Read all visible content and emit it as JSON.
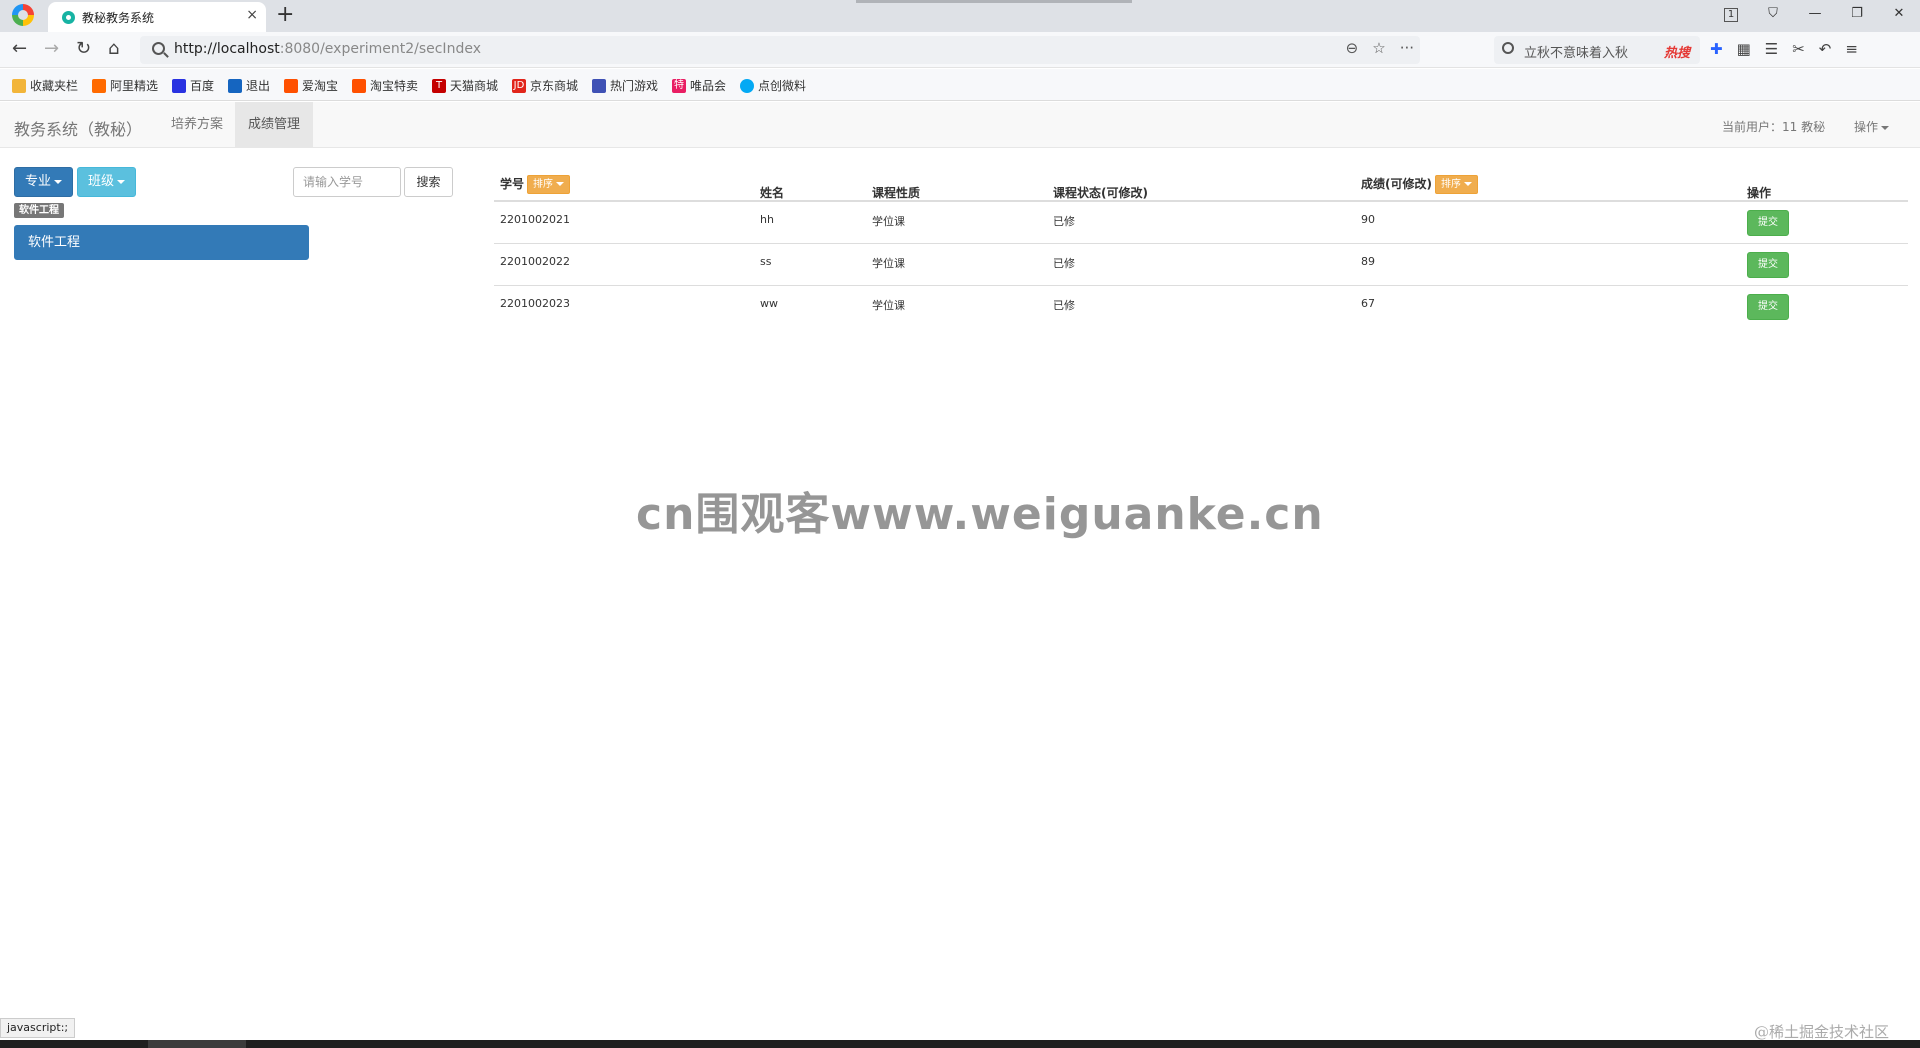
{
  "browser": {
    "tab_title": "教秘教务系统",
    "tab_close": "×",
    "new_tab": "+",
    "url_host": "http://localhost",
    "url_rest": ":8080/experiment2/secIndex",
    "hot_search_text": "立秋不意味着入秋",
    "hot_badge": "热搜",
    "tab_counter": "1",
    "bookmarks": [
      "收藏夹栏",
      "阿里精选",
      "百度",
      "退出",
      "爱淘宝",
      "淘宝特卖",
      "天猫商城",
      "京东商城",
      "热门游戏",
      "唯品会",
      "点创微料"
    ]
  },
  "app": {
    "brand": "教务系统（教秘）",
    "menu": [
      "培养方案",
      "成绩管理"
    ],
    "active_menu_index": 1,
    "current_user": "当前用户：11 教秘",
    "ops_label": "操作"
  },
  "left": {
    "major_button": "专业",
    "class_button": "班级",
    "search_placeholder": "请输入学号",
    "search_button": "搜索",
    "tag": "软件工程",
    "list": [
      "软件工程"
    ]
  },
  "table": {
    "columns": {
      "id": "学号",
      "name": "姓名",
      "course_type": "课程性质",
      "course_status": "课程状态(可修改)",
      "score": "成绩(可修改)",
      "action": "操作"
    },
    "sort_label": "排序",
    "rows": [
      {
        "id": "2201002021",
        "name": "hh",
        "course_type": "学位课",
        "course_status": "已修",
        "score": "90",
        "action": "提交"
      },
      {
        "id": "2201002022",
        "name": "ss",
        "course_type": "学位课",
        "course_status": "已修",
        "score": "89",
        "action": "提交"
      },
      {
        "id": "2201002023",
        "name": "ww",
        "course_type": "学位课",
        "course_status": "已修",
        "score": "67",
        "action": "提交"
      }
    ]
  },
  "overlay": {
    "watermark": "cn围观客www.weiguanke.cn",
    "status_text": "javascript:;",
    "corner_text": "@稀土掘金技术社区"
  },
  "colors": {
    "primary": "#337ab7",
    "info": "#5bc0de",
    "warning": "#f0ad4e",
    "success": "#5cb85c"
  }
}
